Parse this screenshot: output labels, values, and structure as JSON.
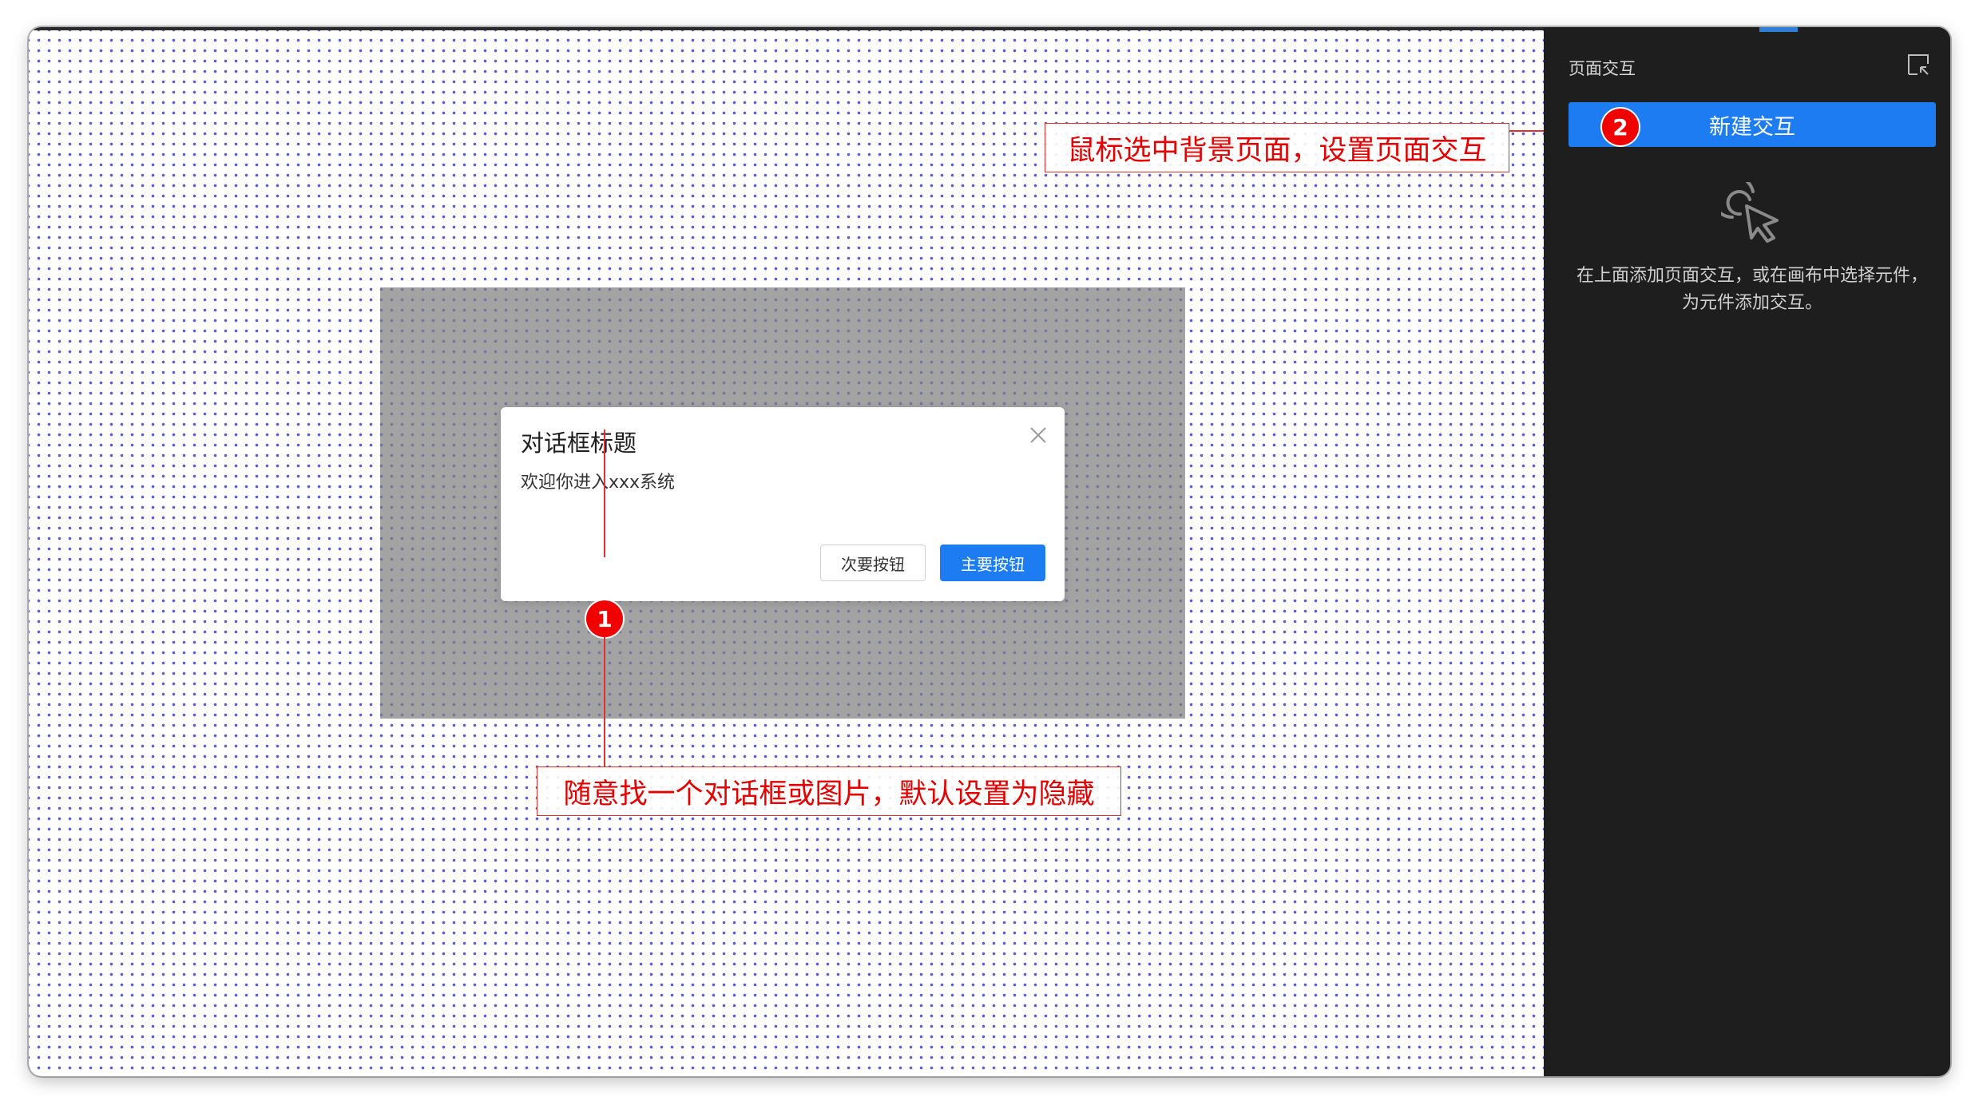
{
  "dialog": {
    "title": "对话框标题",
    "body": "欢迎你进入xxx系统",
    "secondary_button": "次要按钮",
    "primary_button": "主要按钮"
  },
  "annotations": {
    "step1_number": "1",
    "step1_text": "随意找一个对话框或图片，默认设置为隐藏",
    "step2_number": "2",
    "step2_text": "鼠标选中背景页面，设置页面交互"
  },
  "panel": {
    "title": "页面交互",
    "new_button": "新建交互",
    "empty_text": "在上面添加页面交互，或在画布中选择元件，为元件添加交互。"
  },
  "colors": {
    "accent": "#1d7cf2",
    "annotation": "#e60000",
    "panel_bg": "#1e1e1e",
    "overlay": "#808080"
  },
  "icons": {
    "close": "close-icon",
    "collapse": "collapse-panel-icon",
    "empty": "click-pointer-icon"
  }
}
